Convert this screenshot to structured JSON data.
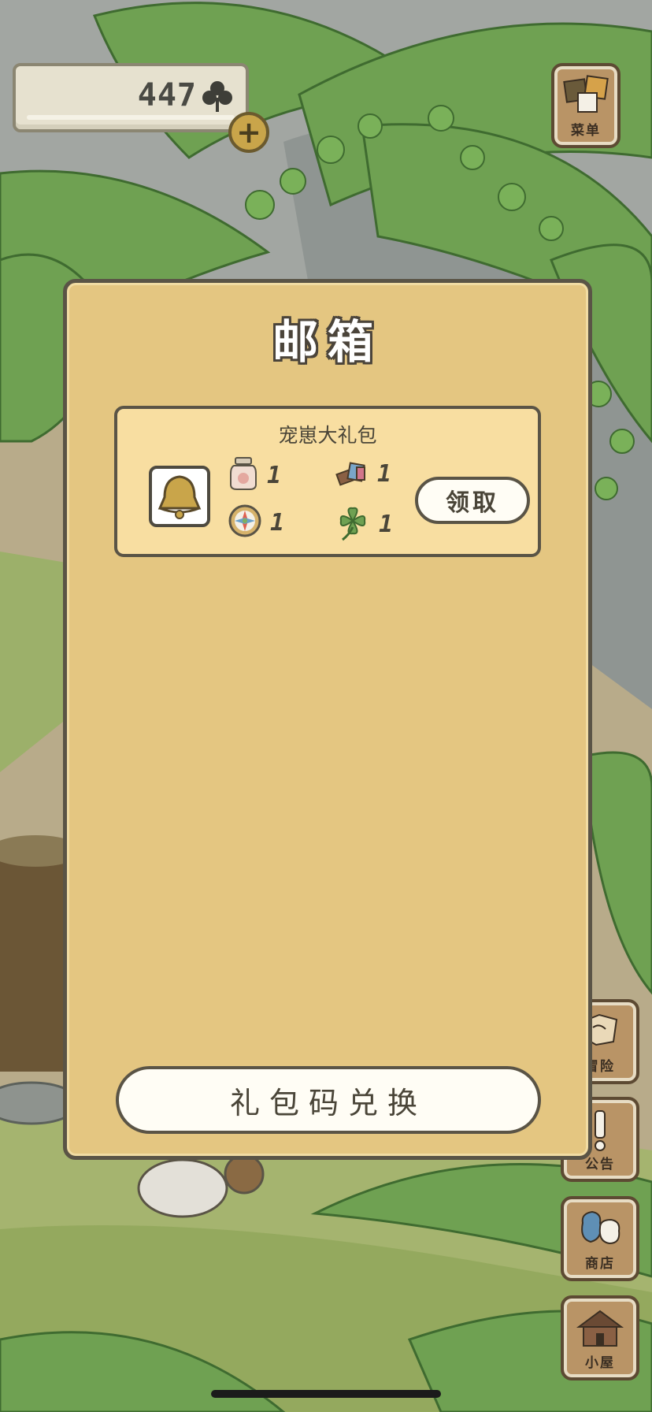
{
  "hud": {
    "clover_count": "447",
    "clover_icon": "clover-icon",
    "add_button": "+"
  },
  "side_menu": {
    "menu_label": "菜单",
    "adventure_label": "冒险",
    "notice_label": "公告",
    "shop_label": "商店",
    "house_label": "小屋"
  },
  "mailbox": {
    "title": "邮箱",
    "items": [
      {
        "title": "宠崽大礼包",
        "icon": "bell-icon",
        "claim_label": "领取",
        "rewards": [
          {
            "icon": "jar-icon",
            "qty": "1"
          },
          {
            "icon": "bread-icon",
            "qty": "1"
          },
          {
            "icon": "compass-icon",
            "qty": "1"
          },
          {
            "icon": "clover-icon",
            "qty": "1"
          }
        ]
      }
    ],
    "redeem_label": "礼包码兑换"
  },
  "colors": {
    "panel_bg": "#e4c681",
    "panel_border": "#5a5446",
    "item_bg": "#f8dea1",
    "button_bg": "#fffdf5",
    "wood": "#b99466"
  }
}
